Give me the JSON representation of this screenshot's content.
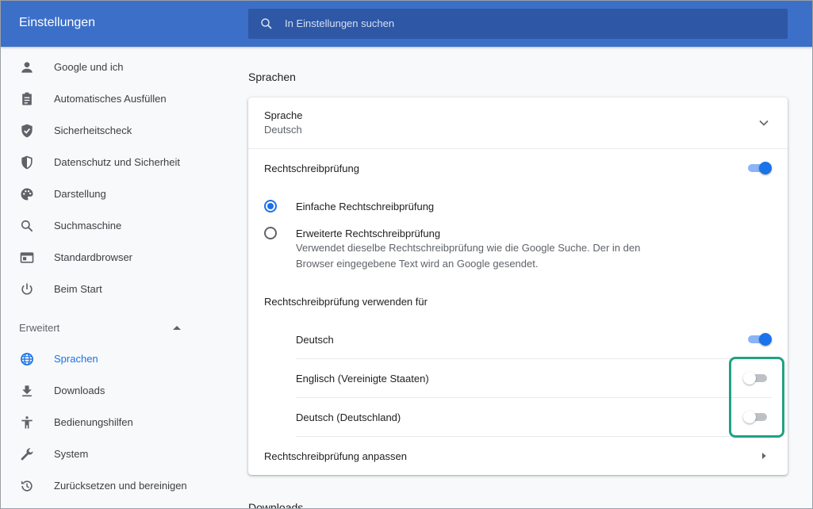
{
  "header": {
    "title": "Einstellungen",
    "search_placeholder": "In Einstellungen suchen"
  },
  "sidebar": {
    "items": [
      {
        "label": "Google und ich",
        "icon": "person-icon"
      },
      {
        "label": "Automatisches Ausfüllen",
        "icon": "clipboard-icon"
      },
      {
        "label": "Sicherheitscheck",
        "icon": "shield-check-icon"
      },
      {
        "label": "Datenschutz und Sicherheit",
        "icon": "shield-half-icon"
      },
      {
        "label": "Darstellung",
        "icon": "palette-icon"
      },
      {
        "label": "Suchmaschine",
        "icon": "search-icon"
      },
      {
        "label": "Standardbrowser",
        "icon": "browser-window-icon"
      },
      {
        "label": "Beim Start",
        "icon": "power-icon"
      }
    ],
    "advanced_label": "Erweitert",
    "advanced_items": [
      {
        "label": "Sprachen",
        "icon": "globe-icon",
        "active": true
      },
      {
        "label": "Downloads",
        "icon": "download-icon"
      },
      {
        "label": "Bedienungshilfen",
        "icon": "accessibility-icon"
      },
      {
        "label": "System",
        "icon": "wrench-icon"
      },
      {
        "label": "Zurücksetzen und bereinigen",
        "icon": "reset-icon"
      }
    ]
  },
  "main": {
    "heading": "Sprachen",
    "language": {
      "title": "Sprache",
      "value": "Deutsch"
    },
    "spellcheck": {
      "label": "Rechtschreibprüfung",
      "enabled": true,
      "basic_label": "Einfache Rechtschreibprüfung",
      "enhanced_label": "Erweiterte Rechtschreibprüfung",
      "enhanced_desc_line1": "Verwendet dieselbe Rechtschreibprüfung wie die Google Suche. Der in den",
      "enhanced_desc_line2": "Browser eingegebene Text wird an Google gesendet.",
      "use_for_label": "Rechtschreibprüfung verwenden für",
      "languages": [
        {
          "name": "Deutsch",
          "enabled": true
        },
        {
          "name": "Englisch (Vereinigte Staaten)",
          "enabled": false
        },
        {
          "name": "Deutsch (Deutschland)",
          "enabled": false
        }
      ],
      "customize_label": "Rechtschreibprüfung anpassen"
    },
    "next_heading": "Downloads"
  },
  "colors": {
    "header": "#3c6fc8",
    "accent": "#1a73e8",
    "highlight": "#22a183"
  }
}
